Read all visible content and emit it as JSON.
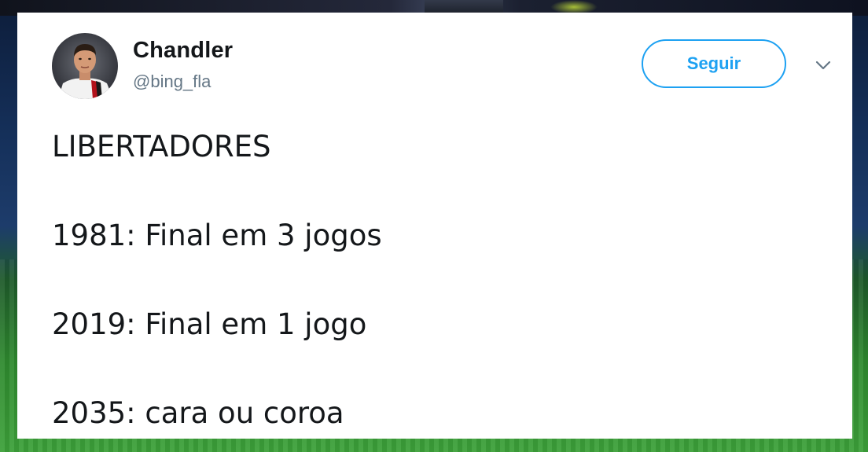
{
  "tweet": {
    "author": {
      "name": "Chandler",
      "handle": "@bing_fla",
      "avatar_icon": "profile-photo"
    },
    "follow_label": "Seguir",
    "menu_icon": "chevron-down-icon",
    "lines": [
      "LIBERTADORES",
      "1981: Final em 3 jogos",
      "2019: Final em 1 jogo",
      "2035: cara ou coroa"
    ]
  },
  "colors": {
    "accent": "#1da1f2",
    "text": "#14171a",
    "muted": "#657786",
    "card": "#ffffff"
  }
}
